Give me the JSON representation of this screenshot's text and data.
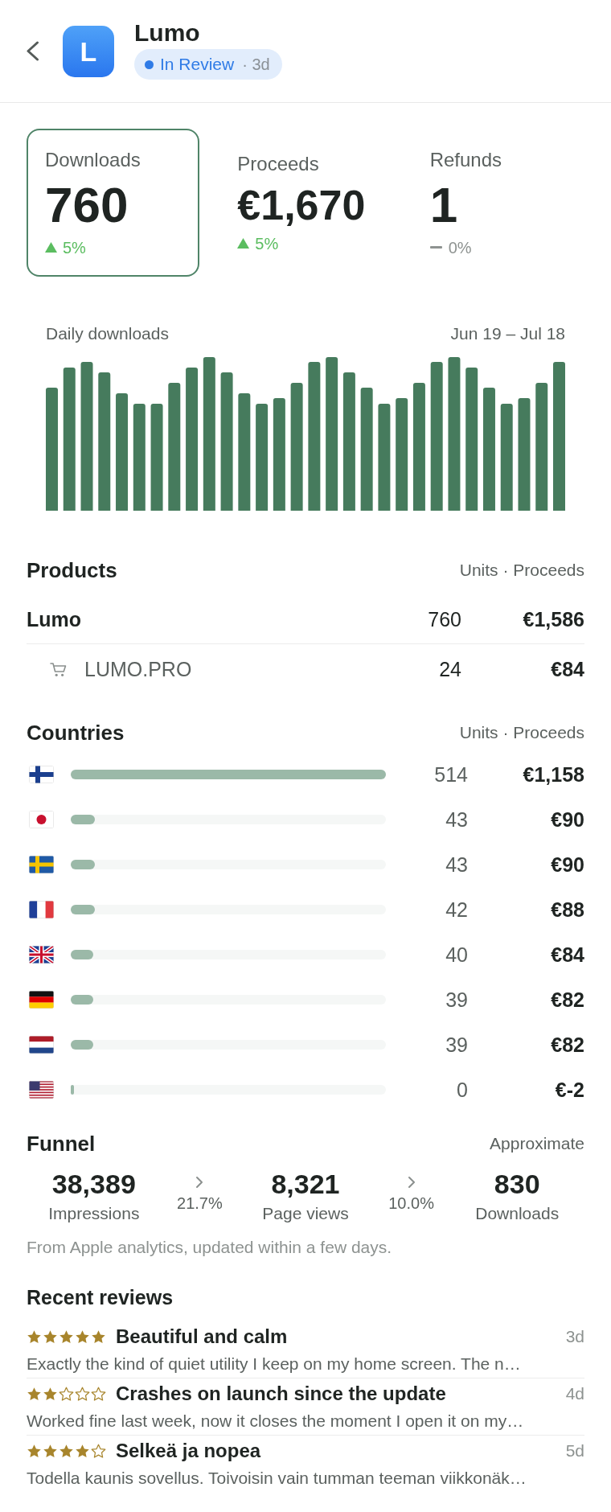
{
  "app": {
    "name": "Lumo",
    "icon_letter": "L",
    "status": {
      "label": "In Review",
      "age": "· 3d"
    }
  },
  "metrics": [
    {
      "label": "Downloads",
      "value": "760",
      "selected": true,
      "change": {
        "kind": "up",
        "text": "5%"
      }
    },
    {
      "label": "Proceeds",
      "value": "€1,670",
      "selected": false,
      "change": {
        "kind": "up",
        "text": "5%"
      }
    },
    {
      "label": "Refunds",
      "value": "1",
      "selected": false,
      "change": {
        "kind": "flat",
        "text": "0%"
      }
    }
  ],
  "chart": {
    "title": "Daily downloads",
    "range": "Jun 19 – Jul 18"
  },
  "products": {
    "title": "Products",
    "columns": "Units · Proceeds",
    "rows": [
      {
        "kind": "app",
        "name": "Lumo",
        "units": "760",
        "proceeds": "€1,586"
      },
      {
        "kind": "purchase",
        "name": "LUMO.PRO",
        "units": "24",
        "proceeds": "€84"
      }
    ]
  },
  "countries": {
    "title": "Countries",
    "columns": "Units · Proceeds",
    "rows": [
      {
        "kind": "finland",
        "level": 1,
        "units": "514",
        "proceeds": "€1,158"
      },
      {
        "kind": "japan",
        "level": 0.077,
        "units": "43",
        "proceeds": "€90"
      },
      {
        "kind": "sweden",
        "level": 0.077,
        "units": "43",
        "proceeds": "€90"
      },
      {
        "kind": "france",
        "level": 0.077,
        "units": "42",
        "proceeds": "€88"
      },
      {
        "kind": "uk",
        "level": 0.071,
        "units": "40",
        "proceeds": "€84"
      },
      {
        "kind": "germany",
        "level": 0.071,
        "units": "39",
        "proceeds": "€82"
      },
      {
        "kind": "netherlands",
        "level": 0.071,
        "units": "39",
        "proceeds": "€82"
      },
      {
        "kind": "usa",
        "level": 0.01,
        "units": "0",
        "proceeds": "€-2"
      }
    ]
  },
  "funnel": {
    "title": "Funnel",
    "note": "Approximate",
    "steps": [
      {
        "value": "38,389",
        "label": "Impressions"
      },
      {
        "value": "8,321",
        "label": "Page views"
      },
      {
        "value": "830",
        "label": "Downloads"
      }
    ],
    "conversions": [
      "21.7%",
      "10.0%"
    ],
    "footnote": "From Apple analytics, updated within a few days."
  },
  "reviews": {
    "title": "Recent reviews",
    "items": [
      {
        "stars": 5,
        "title": "Beautiful and calm",
        "age": "3d",
        "body": "Exactly the kind of quiet utility I keep on my home screen. The n…"
      },
      {
        "stars": 2,
        "title": "Crashes on launch since the update",
        "age": "4d",
        "body": "Worked fine last week, now it closes the moment I open it on my…"
      },
      {
        "stars": 4,
        "title": "Selkeä ja nopea",
        "age": "5d",
        "body": "Todella kaunis sovellus. Toivoisin vain tumman teeman viikkonäk…"
      }
    ]
  }
}
